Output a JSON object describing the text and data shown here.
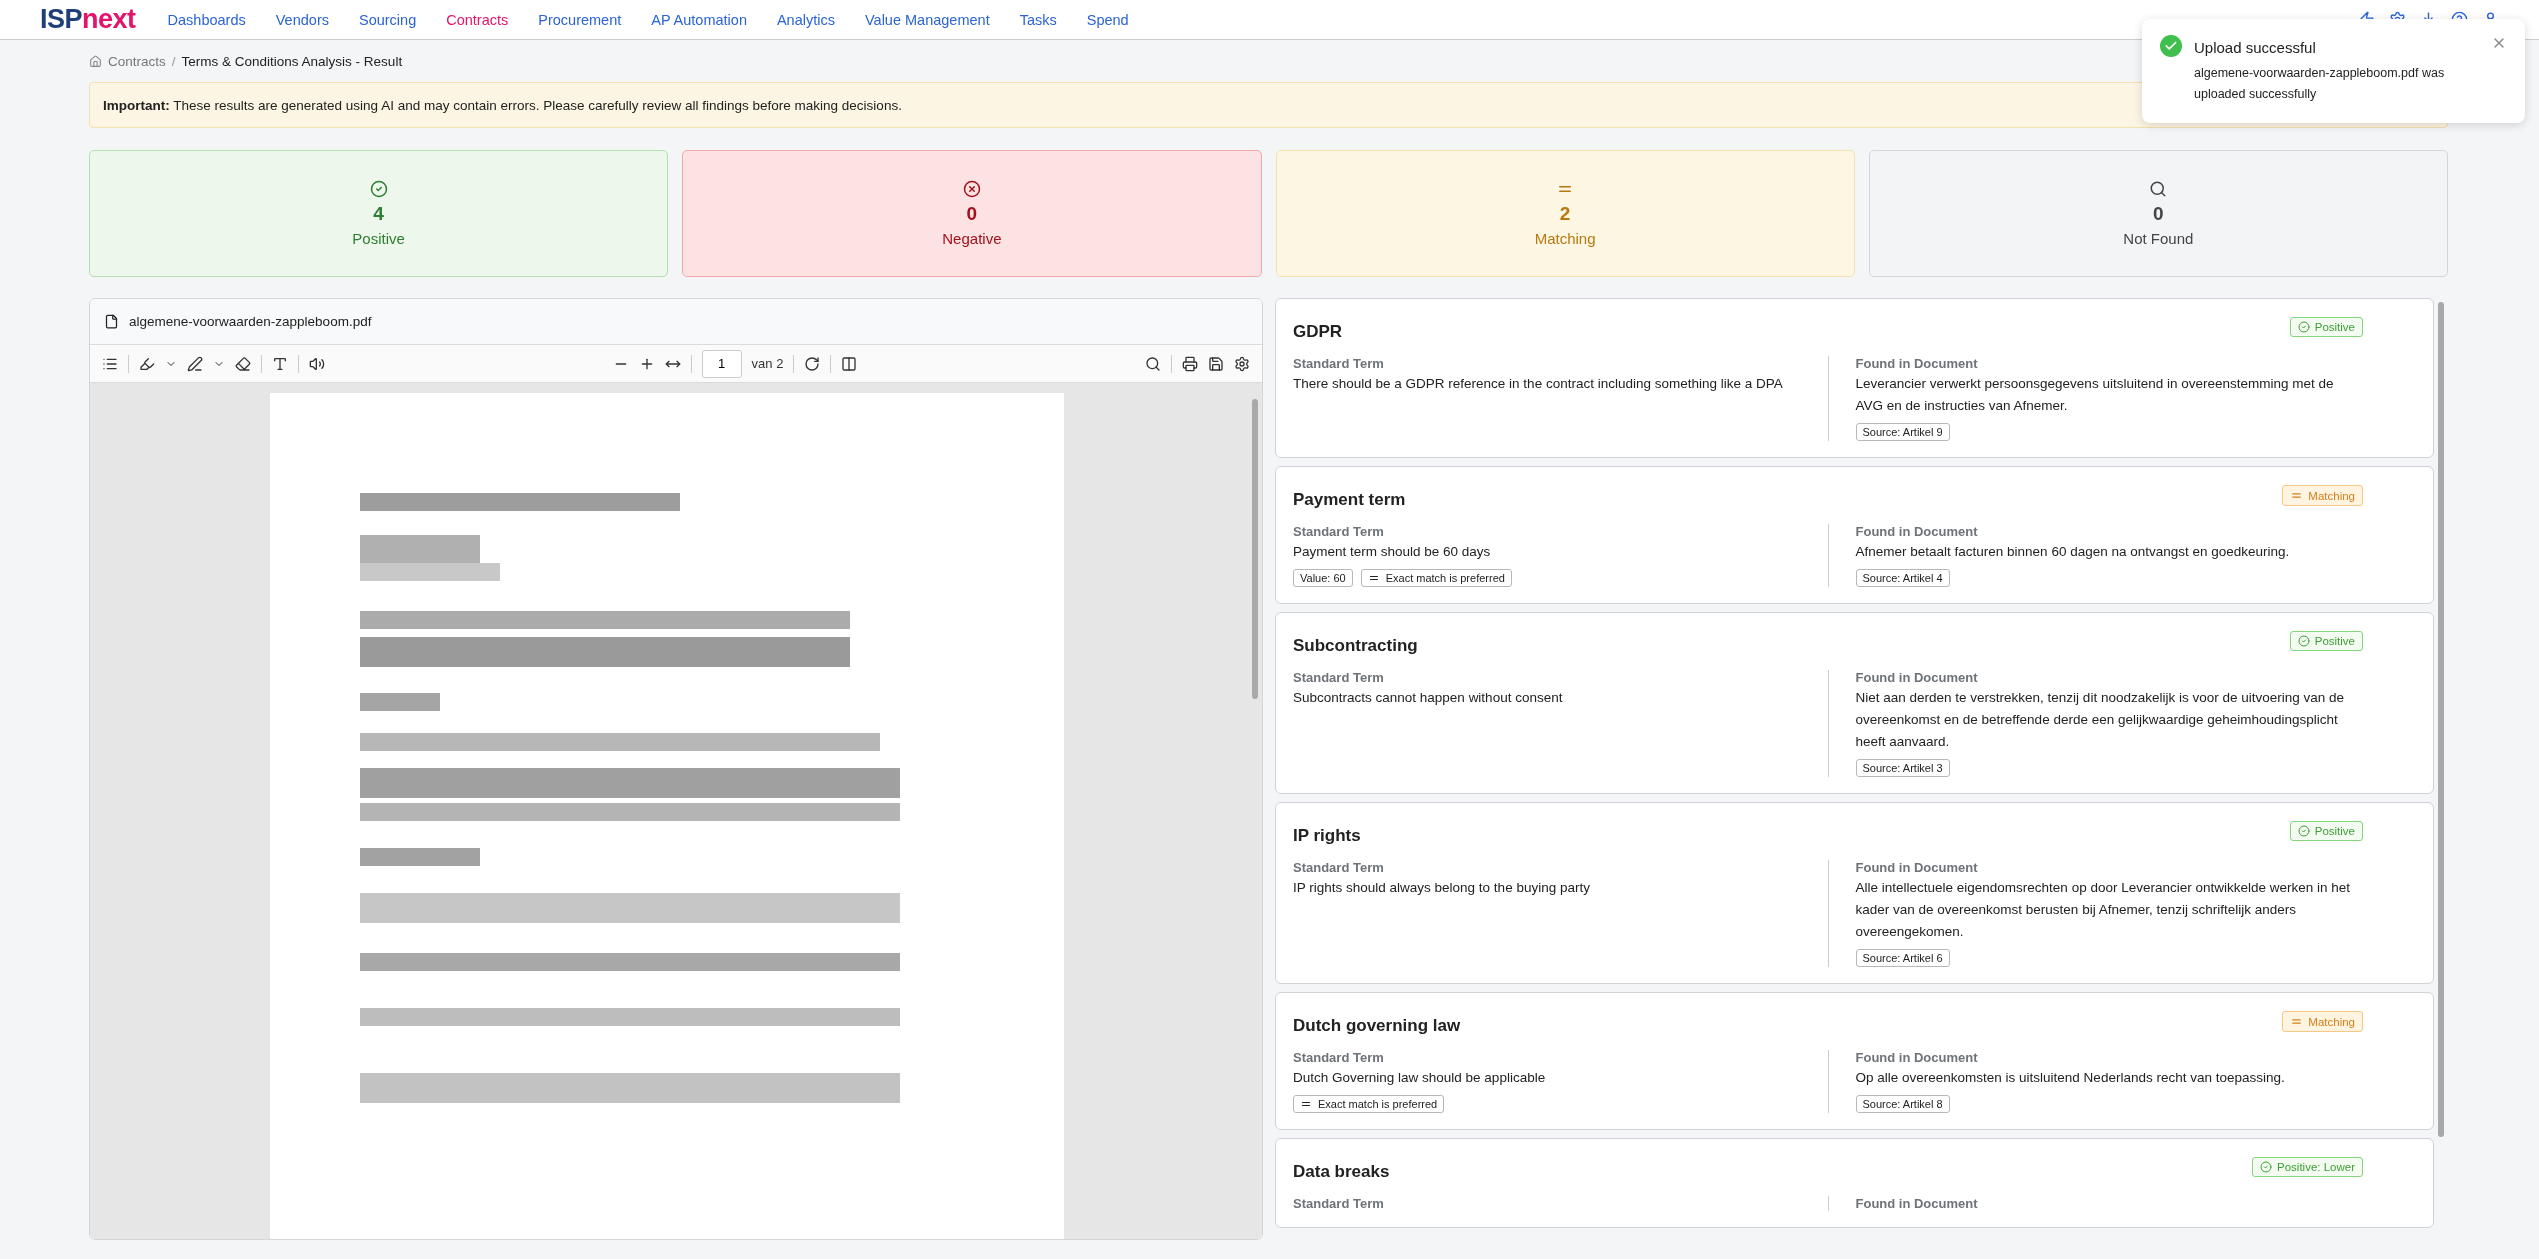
{
  "nav": {
    "logo": {
      "first": "ISP",
      "second": "next"
    },
    "items": [
      {
        "label": "Dashboards",
        "selected": false
      },
      {
        "label": "Vendors",
        "selected": false
      },
      {
        "label": "Sourcing",
        "selected": false
      },
      {
        "label": "Contracts",
        "selected": true
      },
      {
        "label": "Procurement",
        "selected": false
      },
      {
        "label": "AP Automation",
        "selected": false
      },
      {
        "label": "Analytics",
        "selected": false
      },
      {
        "label": "Value Management",
        "selected": false
      },
      {
        "label": "Tasks",
        "selected": false
      },
      {
        "label": "Spend",
        "selected": false
      }
    ]
  },
  "toast": {
    "title": "Upload successful",
    "message": "algemene-voorwaarden-zappleboom.pdf was uploaded successfully"
  },
  "breadcrumb": [
    {
      "label": "Contracts"
    },
    {
      "label": "Terms & Conditions Analysis - Result"
    }
  ],
  "breadcrumb_separator": "/",
  "notice": "**Important:** These results are generated using AI and may contain errors. Please carefully review all findings before making decisions.",
  "summary": [
    {
      "kind": "positive",
      "count": "4",
      "label": "Positive"
    },
    {
      "kind": "negative",
      "count": "0",
      "label": "Negative"
    },
    {
      "kind": "matching",
      "count": "2",
      "label": "Matching"
    },
    {
      "kind": "not_found",
      "count": "0",
      "label": "Not Found"
    }
  ],
  "document": {
    "file_name": "algemene-voorwaarden-zappleboom.pdf",
    "page": "1",
    "page_total": "van 2"
  },
  "findings": [
    {
      "title": "GDPR",
      "status": {
        "kind": "positive",
        "label": "Positive"
      },
      "standard_label": "Standard Term",
      "standard_text": "There should be a GDPR reference in the contract including something like a DPA",
      "found_label": "Found in Document",
      "found_text": "Leverancier verwerkt persoonsgegevens uitsluitend in overeenstemming met de AVG en de instructies van Afnemer.",
      "source": "Source: Artikel 9"
    },
    {
      "title": "Payment term",
      "status": {
        "kind": "matching",
        "label": "Matching"
      },
      "standard_label": "Standard Term",
      "standard_text": "Payment term should be 60 days",
      "tags": [
        {
          "kind": "value",
          "label": "Value: 60"
        },
        {
          "kind": "exact",
          "label": "Exact match is preferred"
        }
      ],
      "found_label": "Found in Document",
      "found_text": "Afnemer betaalt facturen binnen 60 dagen na ontvangst en goedkeuring.",
      "source": "Source: Artikel 4"
    },
    {
      "title": "Subcontracting",
      "status": {
        "kind": "positive",
        "label": "Positive"
      },
      "standard_label": "Standard Term",
      "standard_text": "Subcontracts cannot happen without consent",
      "found_label": "Found in Document",
      "found_text": "Niet aan derden te verstrekken, tenzij dit noodzakelijk is voor de uitvoering van de overeenkomst en de betreffende derde een gelijkwaardige geheimhoudingsplicht heeft aanvaard.",
      "source": "Source: Artikel 3"
    },
    {
      "title": "IP rights",
      "status": {
        "kind": "positive",
        "label": "Positive"
      },
      "standard_label": "Standard Term",
      "standard_text": "IP rights should always belong to the buying party",
      "found_label": "Found in Document",
      "found_text": "Alle intellectuele eigendomsrechten op door Leverancier ontwikkelde werken in het kader van de overeenkomst berusten bij Afnemer, tenzij schriftelijk anders overeengekomen.",
      "source": "Source: Artikel 6"
    },
    {
      "title": "Dutch governing law",
      "status": {
        "kind": "matching",
        "label": "Matching"
      },
      "standard_label": "Standard Term",
      "standard_text": "Dutch Governing law should be applicable",
      "tags": [
        {
          "kind": "exact",
          "label": "Exact match is preferred"
        }
      ],
      "found_label": "Found in Document",
      "found_text": "Op alle overeenkomsten is uitsluitend Nederlands recht van toepassing.",
      "source": "Source: Artikel 8"
    },
    {
      "title": "Data breaks",
      "status": {
        "kind": "positive",
        "label": "Positive: Lower"
      },
      "standard_label": "Standard Term",
      "found_label": "Found in Document"
    }
  ]
}
